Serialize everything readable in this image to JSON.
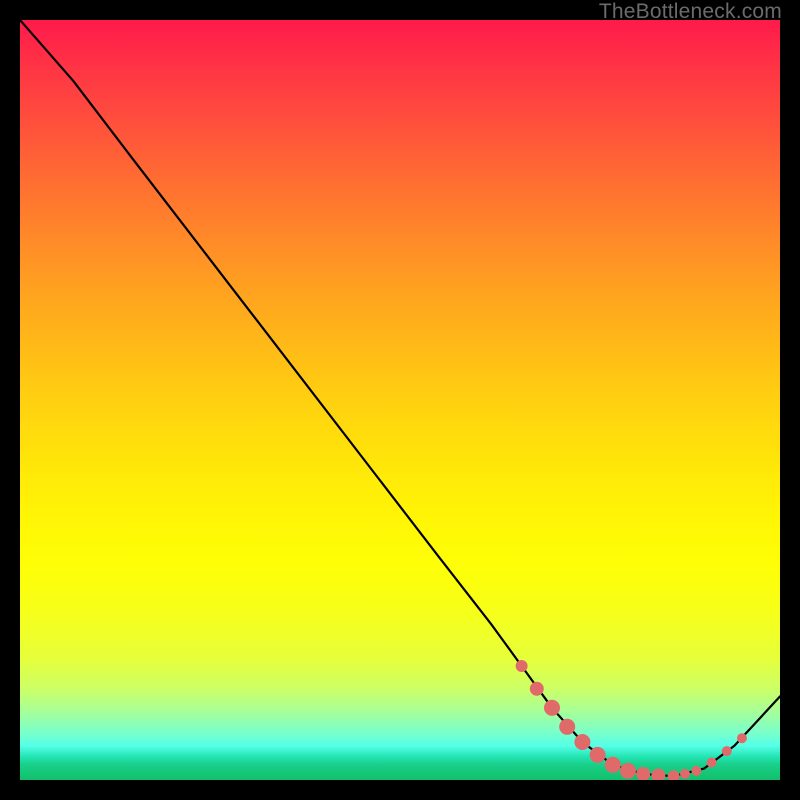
{
  "watermark": "TheBottleneck.com",
  "colors": {
    "line": "#000000",
    "marker_fill": "#e06a6a",
    "marker_stroke": "#c95555"
  },
  "chart_data": {
    "type": "line",
    "title": "",
    "xlabel": "",
    "ylabel": "",
    "xlim": [
      0,
      100
    ],
    "ylim": [
      0,
      100
    ],
    "series": [
      {
        "name": "curve",
        "x": [
          0,
          7,
          15,
          25,
          35,
          45,
          55,
          62,
          66,
          70,
          74,
          78,
          82,
          86,
          90,
          94,
          100
        ],
        "y": [
          100,
          92,
          81.5,
          68.5,
          55.5,
          42.5,
          29.5,
          20.5,
          15,
          9.5,
          5,
          2,
          0.8,
          0.5,
          1.5,
          4.5,
          11
        ]
      }
    ],
    "markers": [
      {
        "x": 66,
        "y": 15,
        "r": 6
      },
      {
        "x": 68,
        "y": 12,
        "r": 7
      },
      {
        "x": 70,
        "y": 9.5,
        "r": 8
      },
      {
        "x": 72,
        "y": 7,
        "r": 8
      },
      {
        "x": 74,
        "y": 5,
        "r": 8
      },
      {
        "x": 76,
        "y": 3.3,
        "r": 8
      },
      {
        "x": 78,
        "y": 2,
        "r": 8
      },
      {
        "x": 80,
        "y": 1.2,
        "r": 8
      },
      {
        "x": 82,
        "y": 0.8,
        "r": 7
      },
      {
        "x": 84,
        "y": 0.6,
        "r": 7
      },
      {
        "x": 86,
        "y": 0.5,
        "r": 6
      },
      {
        "x": 87.5,
        "y": 0.8,
        "r": 5
      },
      {
        "x": 89,
        "y": 1.2,
        "r": 5
      },
      {
        "x": 91,
        "y": 2.3,
        "r": 5
      },
      {
        "x": 93,
        "y": 3.8,
        "r": 5
      },
      {
        "x": 95,
        "y": 5.5,
        "r": 5
      }
    ]
  }
}
